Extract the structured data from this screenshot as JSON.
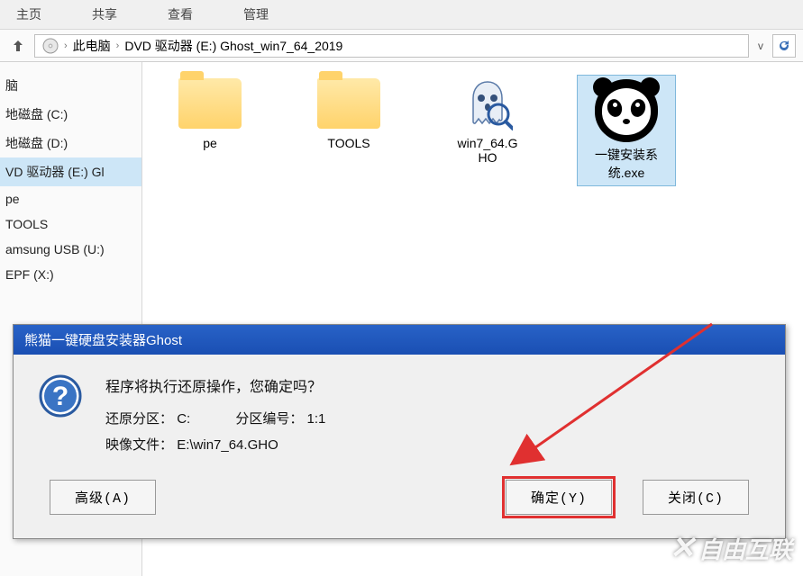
{
  "tabs": {
    "t0": "主页",
    "t1": "共享",
    "t2": "查看",
    "t3": "管理"
  },
  "breadcrumb": {
    "node1": "此电脑",
    "node2": "DVD 驱动器 (E:) Ghost_win7_64_2019"
  },
  "sidebar": {
    "items": [
      "脑",
      "地磁盘 (C:)",
      "地磁盘 (D:)",
      "VD 驱动器 (E:) Gl",
      "pe",
      "TOOLS",
      "amsung USB (U:)",
      "EPF (X:)"
    ]
  },
  "files": {
    "f0": "pe",
    "f1": "TOOLS",
    "f2": "win7_64.G\nHO",
    "f3": "一键安装系\n统.exe"
  },
  "dialog": {
    "title": "熊猫一键硬盘安装器Ghost",
    "headline": "程序将执行还原操作，您确定吗？",
    "row1_label": "还原分区：",
    "row1_value": "C:",
    "row1b_label": "分区编号：",
    "row1b_value": "1:1",
    "row2_label": "映像文件：",
    "row2_value": "E:\\win7_64.GHO",
    "btn_advanced": "高级(A)",
    "btn_ok": "确定(Y)",
    "btn_close": "关闭(C)"
  },
  "watermark": "自由互联"
}
